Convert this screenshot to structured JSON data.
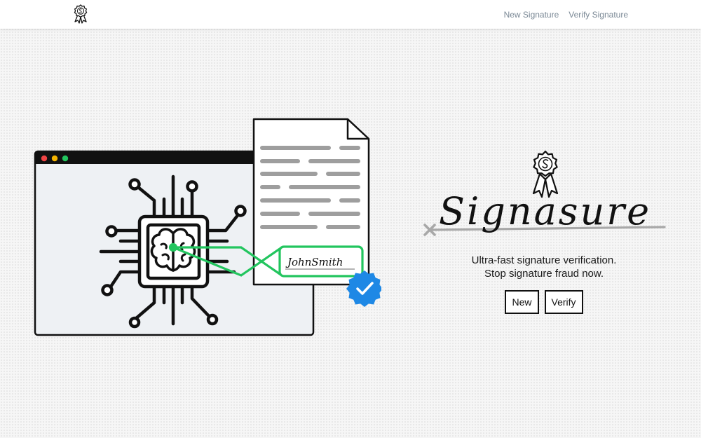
{
  "nav": {
    "links": [
      "New Signature",
      "Verify Signature"
    ]
  },
  "illustration": {
    "signature_text": "JohnSmith"
  },
  "brand": {
    "wordmark": "Signasure",
    "tagline_line1": "Ultra-fast signature verification.",
    "tagline_line2": "Stop signature fraud now."
  },
  "actions": {
    "new_label": "New",
    "verify_label": "Verify"
  },
  "colors": {
    "accent_green": "#22c55e",
    "check_blue": "#1e88e5",
    "nav_link": "#7a8895",
    "line_gray": "#9e9e9e"
  },
  "icons": [
    "ribbon-badge-icon",
    "brain-chip-icon",
    "verified-check-icon",
    "document-icon",
    "window-icon"
  ]
}
